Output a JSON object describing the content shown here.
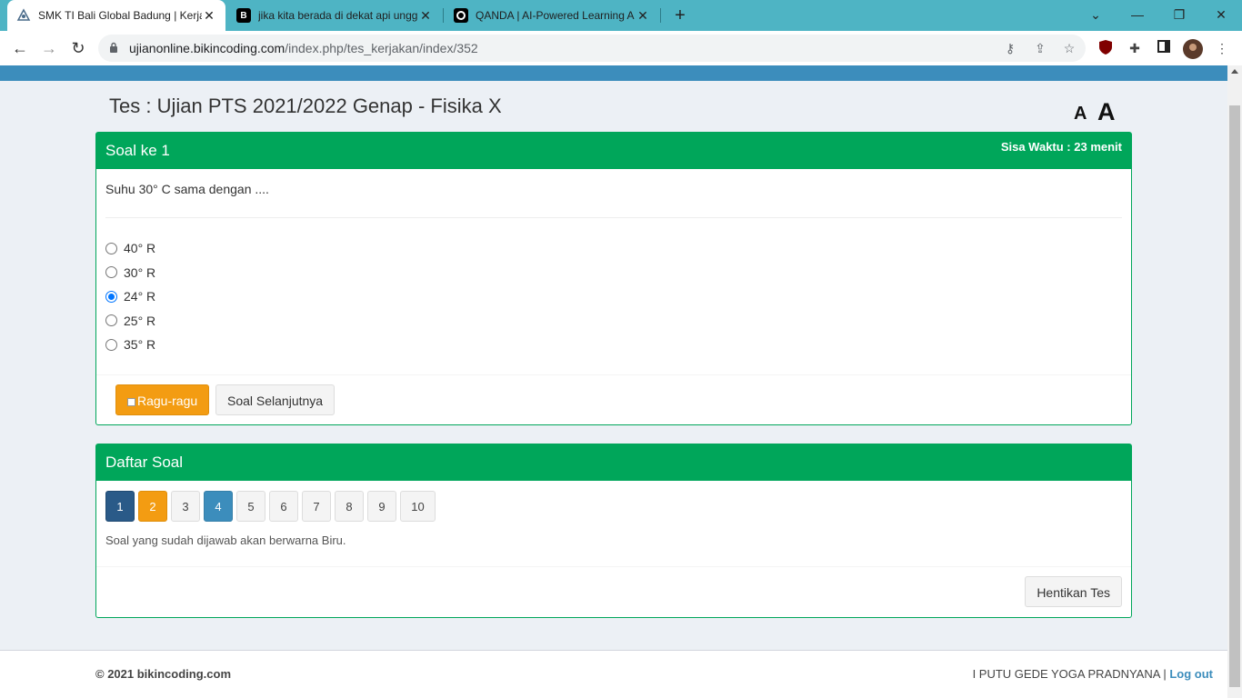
{
  "browser": {
    "tabs": [
      {
        "title": "SMK TI Bali Global Badung | Kerja",
        "icon": "school-logo-icon"
      },
      {
        "title": "jika kita berada di dekat api ungg",
        "icon": "brainly-icon"
      },
      {
        "title": "QANDA | AI-Powered Learning A",
        "icon": "qanda-icon"
      }
    ],
    "url_host": "ujianonline.bikincoding.com",
    "url_path": "/index.php/tes_kerjakan/index/352"
  },
  "page": {
    "title": "Tes : Ujian PTS 2021/2022 Genap - Fisika X",
    "font_small": "A",
    "font_large": "A"
  },
  "question_box": {
    "header": "Soal ke 1",
    "timer": "Sisa Waktu : 23 menit",
    "question": "Suhu 30° C sama dengan ....",
    "options": [
      {
        "label": "40° R",
        "checked": false
      },
      {
        "label": "30° R",
        "checked": false
      },
      {
        "label": "24° R",
        "checked": true
      },
      {
        "label": "25° R",
        "checked": false
      },
      {
        "label": "35° R",
        "checked": false
      }
    ],
    "doubt_label": "Ragu-ragu",
    "next_label": "Soal Selanjutnya"
  },
  "list_box": {
    "header": "Daftar Soal",
    "numbers": [
      {
        "label": "1",
        "state": "current"
      },
      {
        "label": "2",
        "state": "doubt"
      },
      {
        "label": "3",
        "state": "empty"
      },
      {
        "label": "4",
        "state": "answered"
      },
      {
        "label": "5",
        "state": "empty"
      },
      {
        "label": "6",
        "state": "empty"
      },
      {
        "label": "7",
        "state": "empty"
      },
      {
        "label": "8",
        "state": "empty"
      },
      {
        "label": "9",
        "state": "empty"
      },
      {
        "label": "10",
        "state": "empty"
      }
    ],
    "note": "Soal yang sudah dijawab akan berwarna Biru.",
    "stop_label": "Hentikan Tes"
  },
  "footer": {
    "copyright": "© 2021 bikincoding.com",
    "user": "I PUTU GEDE YOGA PRADNYANA",
    "separator": "|",
    "logout": "Log out"
  },
  "colors": {
    "header_green": "#00a65a",
    "accent_blue": "#3c8dbc",
    "warning_orange": "#f39c12",
    "current_dark_blue": "#2a5a88"
  }
}
